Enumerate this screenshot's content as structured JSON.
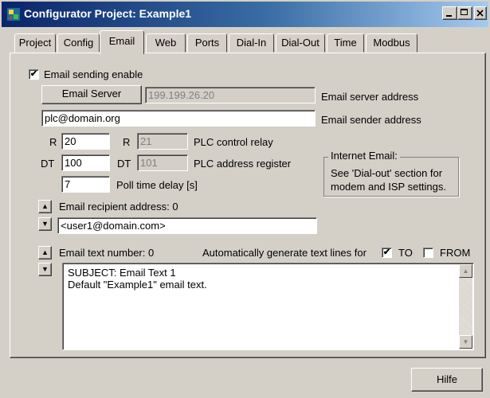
{
  "window": {
    "title": "Configurator Project: Example1"
  },
  "tabs": [
    {
      "label": "Project"
    },
    {
      "label": "Config"
    },
    {
      "label": "Email"
    },
    {
      "label": "Web"
    },
    {
      "label": "Ports"
    },
    {
      "label": "Dial-In"
    },
    {
      "label": "Dial-Out"
    },
    {
      "label": "Time"
    },
    {
      "label": "Modbus"
    }
  ],
  "active_tab": "Email",
  "email": {
    "enable_label": "Email sending enable",
    "enable_checked": true,
    "server_button": "Email Server",
    "server_address": "199.199.26.20",
    "server_address_label": "Email server address",
    "sender_address": "plc@domain.org",
    "sender_address_label": "Email sender address",
    "relay_prefix": "R",
    "relay_value": "20",
    "relay_prefix_2": "R",
    "relay_value_2": "21",
    "relay_label": "PLC control relay",
    "register_prefix": "DT",
    "register_value": "100",
    "register_prefix_2": "DT",
    "register_value_2": "101",
    "register_label": "PLC address register",
    "poll_value": "7",
    "poll_label": "Poll time delay [s]",
    "internet_group_title": "Internet Email:",
    "internet_group_text_1": "See 'Dial-out' section for",
    "internet_group_text_2": "modem and ISP settings.",
    "recipient_label": "Email recipient address: 0",
    "recipient_value": "<user1@domain.com>",
    "text_number_label": "Email text number: 0",
    "autogen_label": "Automatically generate text lines for",
    "to_label": "TO",
    "to_checked": true,
    "from_label": "FROM",
    "from_checked": false,
    "text_content": "SUBJECT: Email Text 1\nDefault \"Example1\" email text."
  },
  "footer": {
    "help_button": "Hilfe"
  },
  "icons": {
    "app": "configurator-app-icon",
    "minimize": "minimize-icon",
    "maximize": "maximize-icon",
    "close": "close-icon",
    "spin_up": "arrow-up-icon",
    "spin_down": "arrow-down-icon",
    "check": "checkmark-icon"
  },
  "colors": {
    "titlebar_start": "#0a246a",
    "titlebar_end": "#a6caf0",
    "face": "#d4d0c8"
  }
}
